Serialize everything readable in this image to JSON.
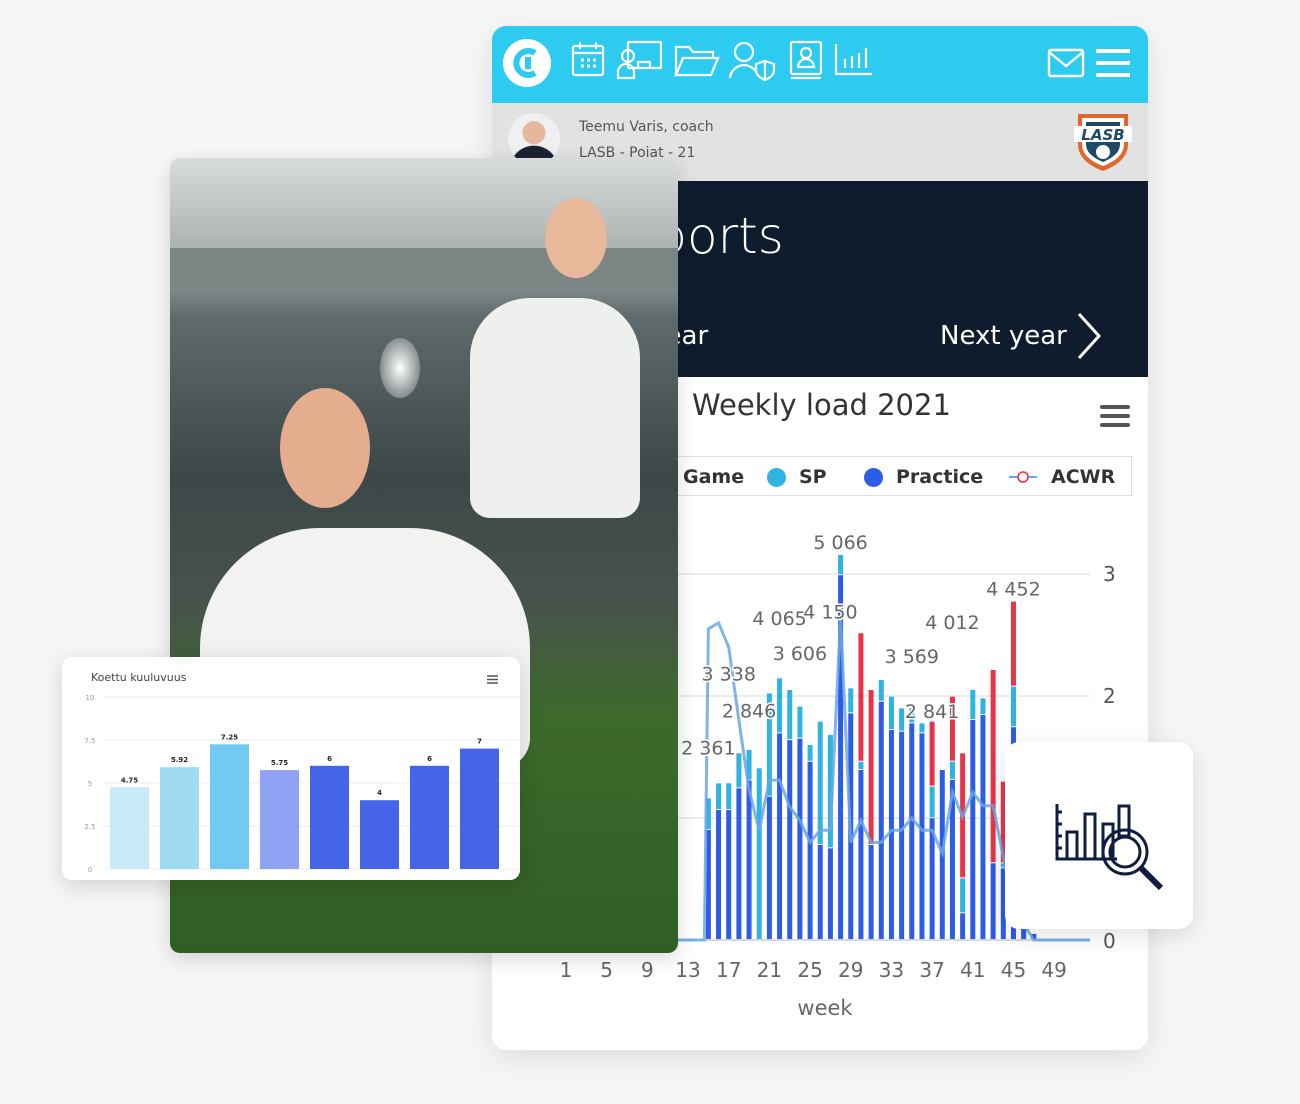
{
  "header": {
    "icons": [
      "app-logo-icon",
      "calendar-icon",
      "presentation-icon",
      "folder-icon",
      "user-shield-icon",
      "profile-book-icon",
      "bar-chart-icon",
      "mail-icon",
      "hamburger-menu-icon"
    ],
    "accent": "#2ecbf0"
  },
  "user": {
    "name": "Teemu Varis, coach",
    "team": "LASB - Poiat - 21",
    "club_logo_text": "LASB"
  },
  "banner": {
    "title": "Reports",
    "prev_label": "Previous year",
    "next_label": "Next year"
  },
  "weekly_chart_title": "Weekly load 2021",
  "legend": [
    {
      "label": "Game",
      "color": "#e8344a"
    },
    {
      "label": "SP",
      "color": "#2fb3e0"
    },
    {
      "label": "Practice",
      "color": "#2d5ce8"
    },
    {
      "label": "ACWR",
      "color": "#e8344a"
    }
  ],
  "chart_data": [
    {
      "type": "bar",
      "stacked": true,
      "title": "Weekly load 2021",
      "xlabel": "week",
      "x_ticks": [
        1,
        5,
        9,
        13,
        17,
        21,
        25,
        29,
        33,
        37,
        41,
        45,
        49
      ],
      "y2_ticks": [
        0,
        1,
        2,
        3
      ],
      "y2_ylim": [
        0,
        3
      ],
      "weeks": [
        15,
        16,
        17,
        18,
        19,
        20,
        21,
        22,
        23,
        24,
        25,
        26,
        27,
        28,
        29,
        30,
        31,
        32,
        33,
        34,
        35,
        36,
        37,
        38,
        39,
        40,
        41,
        42,
        43,
        44,
        45,
        46,
        47
      ],
      "series": [
        {
          "name": "Game",
          "color": "#e8344a",
          "values": [
            0,
            0,
            0,
            0,
            0,
            0,
            0,
            0,
            0,
            0,
            0,
            0,
            0,
            0,
            0,
            1690,
            2040,
            0,
            0,
            0,
            0,
            0,
            855,
            0,
            855,
            1645,
            0,
            0,
            2544,
            1075,
            1118,
            0,
            0
          ]
        },
        {
          "name": "SP",
          "color": "#2fb3e0",
          "values": [
            417,
            351,
            351,
            460,
            400,
            2259,
            1359,
            724,
            660,
            420,
            220,
            1623,
            1491,
            266,
            329,
            108,
            0,
            285,
            439,
            307,
            197,
            132,
            417,
            0,
            242,
            460,
            395,
            220,
            0,
            65,
            534,
            0,
            0
          ]
        },
        {
          "name": "Practice",
          "color": "#2d5ce8",
          "values": [
            1447,
            1710,
            1710,
            1996,
            2100,
            0,
            1886,
            2719,
            2630,
            2650,
            2346,
            1250,
            1206,
            4800,
            2982,
            2237,
            1250,
            3136,
            2763,
            2741,
            2851,
            2719,
            1601,
            2237,
            2105,
            351,
            2895,
            2960,
            1009,
            943,
            2800,
            200,
            80
          ]
        },
        {
          "name": "ACWR",
          "type": "line",
          "axis": "right",
          "color": "#6aa6e8",
          "values": [
            2.55,
            2.6,
            2.4,
            1.8,
            1.23,
            0.9,
            1.31,
            1.31,
            1.09,
            0.98,
            0.8,
            0.9,
            0.9,
            2.65,
            0.8,
            0.98,
            0.8,
            0.8,
            0.9,
            0.9,
            1.0,
            0.9,
            0.9,
            0.71,
            1.21,
            1.01,
            1.21,
            1.1,
            1.1,
            0.68,
            0.27,
            0.13,
            0
          ]
        }
      ],
      "data_labels": [
        {
          "week": 15,
          "text": "2 361",
          "value": 2361
        },
        {
          "week": 17,
          "text": "3 338",
          "value": 3338
        },
        {
          "week": 19,
          "text": "2 846",
          "value": 2846
        },
        {
          "week": 22,
          "text": "4 065",
          "value": 4065
        },
        {
          "week": 24,
          "text": "3 606",
          "value": 3606
        },
        {
          "week": 27,
          "text": "4 150",
          "value": 4150
        },
        {
          "week": 28,
          "text": "5 066",
          "value": 5066
        },
        {
          "week": 35,
          "text": "3 569",
          "value": 3569
        },
        {
          "week": 37,
          "text": "2 841",
          "value": 2841
        },
        {
          "week": 39,
          "text": "4 012",
          "value": 4012
        },
        {
          "week": 45,
          "text": "4 452",
          "value": 4452
        }
      ]
    },
    {
      "type": "bar",
      "title": "Koettu kuuluvuus",
      "ylim": [
        0,
        10
      ],
      "y_ticks": [
        "0",
        "2.5",
        "5",
        "7.5",
        "10"
      ],
      "values": [
        4.75,
        5.92,
        7.25,
        5.75,
        6,
        4,
        6,
        7
      ],
      "value_labels": [
        "4.75",
        "5.92",
        "7.25",
        "5.75",
        "6",
        "4",
        "6",
        "7"
      ],
      "colors": [
        "#c8eaf6",
        "#9fdcf3",
        "#72c9f2",
        "#8fa2f3",
        "#4465e8",
        "#4465e8",
        "#4465e8",
        "#4465e8"
      ]
    }
  ]
}
